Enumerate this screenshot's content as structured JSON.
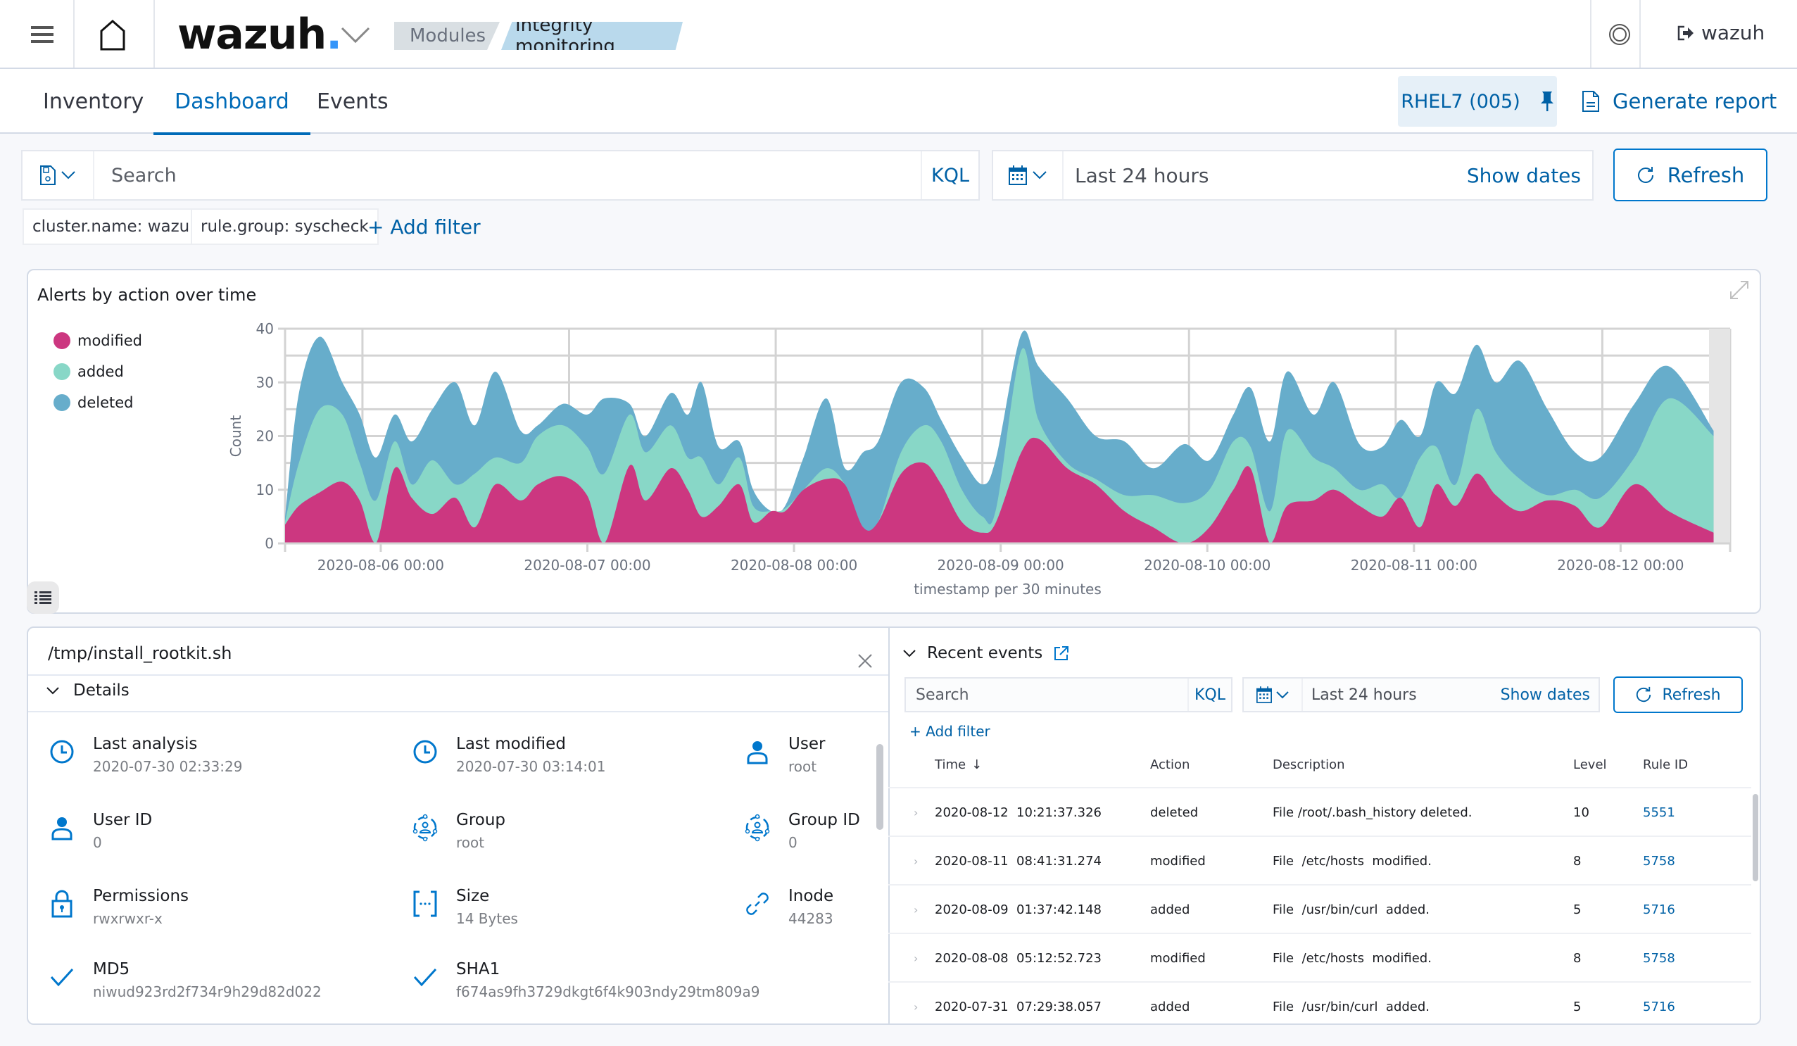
{
  "header": {
    "logo_text": "wazuh",
    "logo_dot": ".",
    "breadcrumb": [
      "Modules",
      "Integrity monitoring"
    ],
    "user": "wazuh",
    "icons": {
      "menu": "hamburger-icon",
      "home": "home-icon",
      "dropdown": "chevron-down-icon",
      "help": "lifebuoy-icon",
      "logout": "logout-icon"
    }
  },
  "tabs": [
    {
      "label": "Inventory",
      "active": false
    },
    {
      "label": "Dashboard",
      "active": true
    },
    {
      "label": "Events",
      "active": false
    }
  ],
  "agent": {
    "label": "RHEL7 (005)",
    "icon": "pin-icon"
  },
  "generate_report": {
    "label": "Generate report",
    "icon": "document-icon"
  },
  "search": {
    "placeholder": "Search",
    "language": "KQL",
    "time_range": "Last 24 hours",
    "show_dates": "Show dates",
    "refresh": "Refresh"
  },
  "filters": {
    "pills": [
      "cluster.name: wazuh",
      "rule.group: syscheck"
    ],
    "add_filter": "+ Add filter"
  },
  "colors": {
    "modified": "#cc3780",
    "added": "#88d7c7",
    "deleted": "#67adcb",
    "accent": "#006bb8"
  },
  "chart_data": {
    "type": "area",
    "stacked": true,
    "smooth": true,
    "title": "Alerts by action over time",
    "xlabel": "timestamp per 30 minutes",
    "ylabel": "Count",
    "ylim": [
      0,
      40
    ],
    "yticks": [
      0,
      10,
      20,
      30,
      40
    ],
    "grid": true,
    "legend_position": "left",
    "xlim": [
      "2020-08-05 12:40",
      "2020-08-12 17:20"
    ],
    "xtick_labels": [
      "2020-08-06 00:00",
      "2020-08-07 00:00",
      "2020-08-08 00:00",
      "2020-08-09 00:00",
      "2020-08-10 00:00",
      "2020-08-11 00:00",
      "2020-08-12 00:00"
    ],
    "x_days_offset": [
      -0.463,
      -0.396,
      -0.296,
      -0.186,
      -0.102,
      -0.024,
      0.067,
      0.15,
      0.25,
      0.361,
      0.455,
      0.555,
      0.677,
      0.76,
      0.882,
      0.998,
      1.081,
      1.204,
      1.281,
      1.403,
      1.486,
      1.552,
      1.635,
      1.735,
      1.802,
      1.89,
      1.957,
      2.046,
      2.157,
      2.246,
      2.335,
      2.407,
      2.518,
      2.629,
      2.712,
      2.812,
      2.912,
      2.978,
      3.1,
      3.183,
      3.322,
      3.46,
      3.599,
      3.738,
      3.888,
      4.01,
      4.126,
      4.209,
      4.303,
      4.386,
      4.514,
      4.614,
      4.736,
      4.847,
      4.936,
      5.03,
      5.108,
      5.202,
      5.302,
      5.396,
      5.512,
      5.646,
      5.779,
      5.901,
      6.067,
      6.233,
      6.45
    ],
    "series": [
      {
        "name": "modified",
        "values": [
          3.5,
          7,
          9.5,
          11.5,
          8,
          0,
          14,
          8.5,
          5.5,
          8.5,
          3,
          11,
          8,
          11,
          12.5,
          9,
          0,
          14.5,
          8,
          14,
          10,
          5,
          7,
          11,
          4,
          6,
          6,
          10,
          12,
          11,
          3,
          4,
          13,
          15,
          11,
          4,
          2,
          4,
          17,
          19.5,
          14,
          11,
          6,
          3,
          0,
          3,
          10,
          14,
          0,
          7,
          8,
          10,
          7,
          5,
          8.5,
          3,
          11,
          7,
          13,
          9,
          6,
          8,
          7,
          3,
          11,
          6,
          2
        ]
      },
      {
        "name": "added",
        "values": [
          0.5,
          8,
          15.5,
          12.5,
          7,
          8,
          5,
          2.5,
          10,
          2.5,
          10,
          5,
          7,
          9,
          9.5,
          9,
          13,
          9.5,
          9,
          8,
          6,
          11,
          4,
          5,
          3,
          0,
          0.5,
          0,
          2,
          0,
          0,
          0,
          4,
          7,
          8,
          6,
          3,
          2.5,
          19,
          3.5,
          1,
          1,
          3,
          6,
          7.5,
          7,
          9,
          4,
          6,
          14,
          8,
          4,
          3,
          6,
          0,
          13,
          7,
          4,
          12,
          8,
          6,
          1,
          3,
          5.5,
          5,
          21,
          18
        ]
      },
      {
        "name": "deleted",
        "values": [
          1,
          13,
          13.5,
          6,
          9,
          8,
          5,
          8,
          9.5,
          19,
          9,
          16,
          6,
          2,
          4,
          6,
          14,
          2,
          3,
          6,
          8,
          14,
          7,
          3,
          3,
          0,
          0.5,
          6,
          13,
          3,
          14,
          15,
          13,
          7,
          4,
          6,
          6,
          9.5,
          3,
          10,
          12,
          8,
          10,
          5,
          11,
          5.5,
          5,
          11,
          13,
          11,
          8,
          16,
          8.5,
          7,
          14.5,
          4,
          12,
          17,
          12,
          13,
          22,
          16,
          7,
          7.5,
          10,
          6,
          1
        ]
      }
    ]
  },
  "chart_ui": {
    "expand_icon": "expand-icon",
    "legend_toggle_icon": "list-icon"
  },
  "file_details": {
    "path": "/tmp/install_rootkit.sh",
    "section": "Details",
    "fields": [
      {
        "label": "Last analysis",
        "value": "2020-07-30 02:33:29",
        "icon": "clock-icon"
      },
      {
        "label": "Last modified",
        "value": "2020-07-30 03:14:01",
        "icon": "clock-icon"
      },
      {
        "label": "User",
        "value": "root",
        "icon": "user-icon"
      },
      {
        "label": "User ID",
        "value": "0",
        "icon": "user-icon"
      },
      {
        "label": "Group",
        "value": "root",
        "icon": "group-icon"
      },
      {
        "label": "Group ID",
        "value": "0",
        "icon": "group-icon"
      },
      {
        "label": "Permissions",
        "value": "rwxrwxr-x",
        "icon": "lock-icon"
      },
      {
        "label": "Size",
        "value": "14 Bytes",
        "icon": "size-icon"
      },
      {
        "label": "Inode",
        "value": "44283",
        "icon": "link-icon"
      },
      {
        "label": "MD5",
        "value": "niwud923rd2f734r9h29d82d022",
        "icon": "check-icon"
      },
      {
        "label": "SHA1",
        "value": "f674as9fh3729dkgt6f4k903ndy29tm809a9",
        "icon": "check-icon"
      }
    ]
  },
  "recent_events": {
    "title": "Recent events",
    "search_placeholder": "Search",
    "language": "KQL",
    "time_range": "Last 24 hours",
    "show_dates": "Show dates",
    "refresh": "Refresh",
    "add_filter": "+ Add filter",
    "columns": [
      "Time",
      "Action",
      "Description",
      "Level",
      "Rule ID"
    ],
    "sort_indicator": "↓",
    "rows": [
      {
        "time": "2020-08-12  10:21:37.326",
        "action": "deleted",
        "description": "File /root/.bash_history deleted.",
        "level": "10",
        "rule_id": "5551"
      },
      {
        "time": "2020-08-11  08:41:31.274",
        "action": "modified",
        "description": "File  /etc/hosts  modified.",
        "level": "8",
        "rule_id": "5758"
      },
      {
        "time": "2020-08-09  01:37:42.148",
        "action": "added",
        "description": "File  /usr/bin/curl  added.",
        "level": "5",
        "rule_id": "5716"
      },
      {
        "time": "2020-08-08  05:12:52.723",
        "action": "modified",
        "description": "File  /etc/hosts  modified.",
        "level": "8",
        "rule_id": "5758"
      },
      {
        "time": "2020-07-31  07:29:38.057",
        "action": "added",
        "description": "File  /usr/bin/curl  added.",
        "level": "5",
        "rule_id": "5716"
      }
    ]
  }
}
